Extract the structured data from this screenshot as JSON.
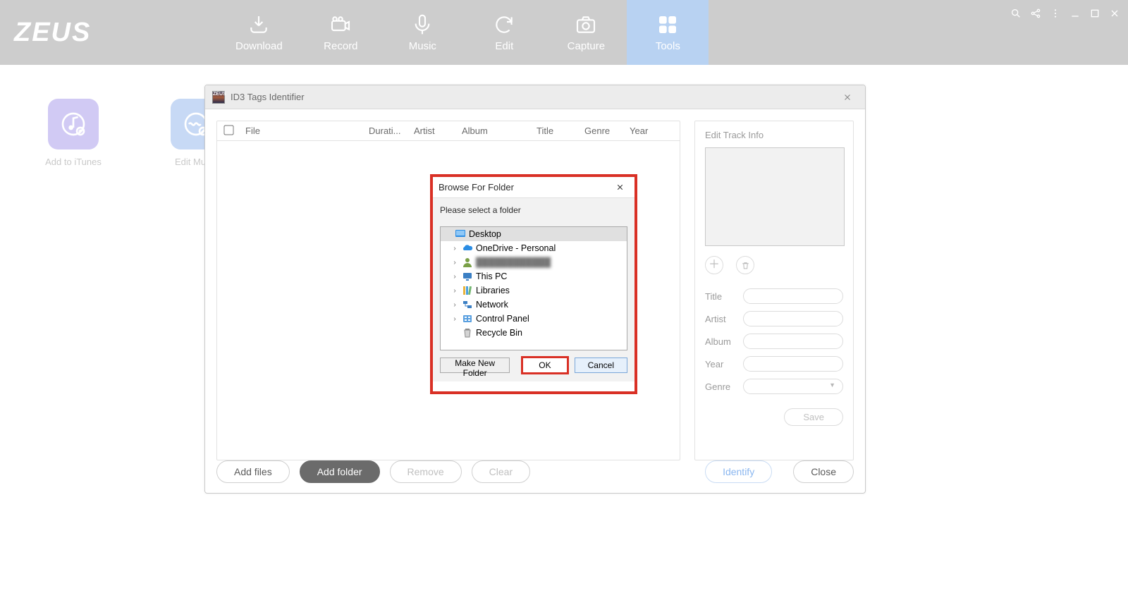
{
  "app_logo": "ZEUS",
  "nav": [
    {
      "label": "Download"
    },
    {
      "label": "Record"
    },
    {
      "label": "Music"
    },
    {
      "label": "Edit"
    },
    {
      "label": "Capture"
    },
    {
      "label": "Tools",
      "active": true
    }
  ],
  "tiles": {
    "itunes": "Add to iTunes",
    "edit": "Edit Music"
  },
  "id3": {
    "title": "ID3 Tags Identifier",
    "headers": {
      "file": "File",
      "duration": "Durati...",
      "artist": "Artist",
      "album": "Album",
      "title": "Title",
      "genre": "Genre",
      "year": "Year"
    },
    "edit_panel": {
      "title": "Edit Track Info",
      "fields": {
        "title": "Title",
        "artist": "Artist",
        "album": "Album",
        "year": "Year",
        "genre": "Genre"
      },
      "save": "Save"
    },
    "buttons": {
      "add_files": "Add files",
      "add_folder": "Add folder",
      "remove": "Remove",
      "clear": "Clear",
      "identify": "Identify",
      "close": "Close"
    }
  },
  "folder_dialog": {
    "title": "Browse For Folder",
    "prompt": "Please select a folder",
    "tree": {
      "desktop": "Desktop",
      "onedrive": "OneDrive - Personal",
      "user": "████████████",
      "this_pc": "This PC",
      "libraries": "Libraries",
      "network": "Network",
      "control_panel": "Control Panel",
      "recycle_bin": "Recycle Bin"
    },
    "buttons": {
      "make": "Make New Folder",
      "ok": "OK",
      "cancel": "Cancel"
    }
  }
}
